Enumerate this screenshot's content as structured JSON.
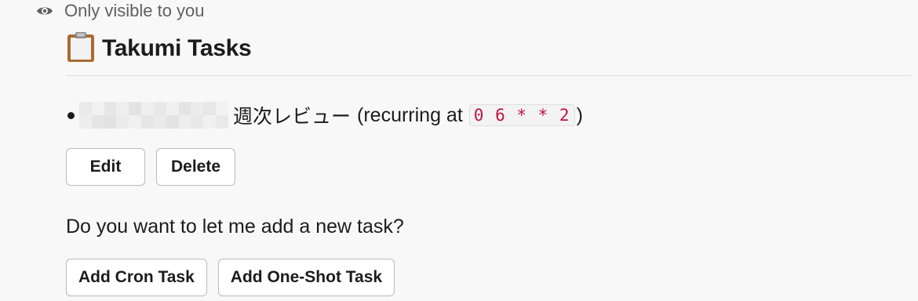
{
  "visibility": {
    "icon": "eye-icon",
    "text": "Only visible to you"
  },
  "header": {
    "icon": "clipboard-icon",
    "title": "Takumi Tasks"
  },
  "task": {
    "name": "週次レビュー",
    "prefix": "(recurring at",
    "schedule": "0 6 * * 2",
    "suffix": ")"
  },
  "task_actions": {
    "edit_label": "Edit",
    "delete_label": "Delete"
  },
  "question": "Do you want to let me add a new task?",
  "add_actions": {
    "cron_label": "Add Cron Task",
    "oneshot_label": "Add One-Shot Task"
  },
  "colors": {
    "code_text": "#c01343",
    "background": "#f8f8f8"
  }
}
